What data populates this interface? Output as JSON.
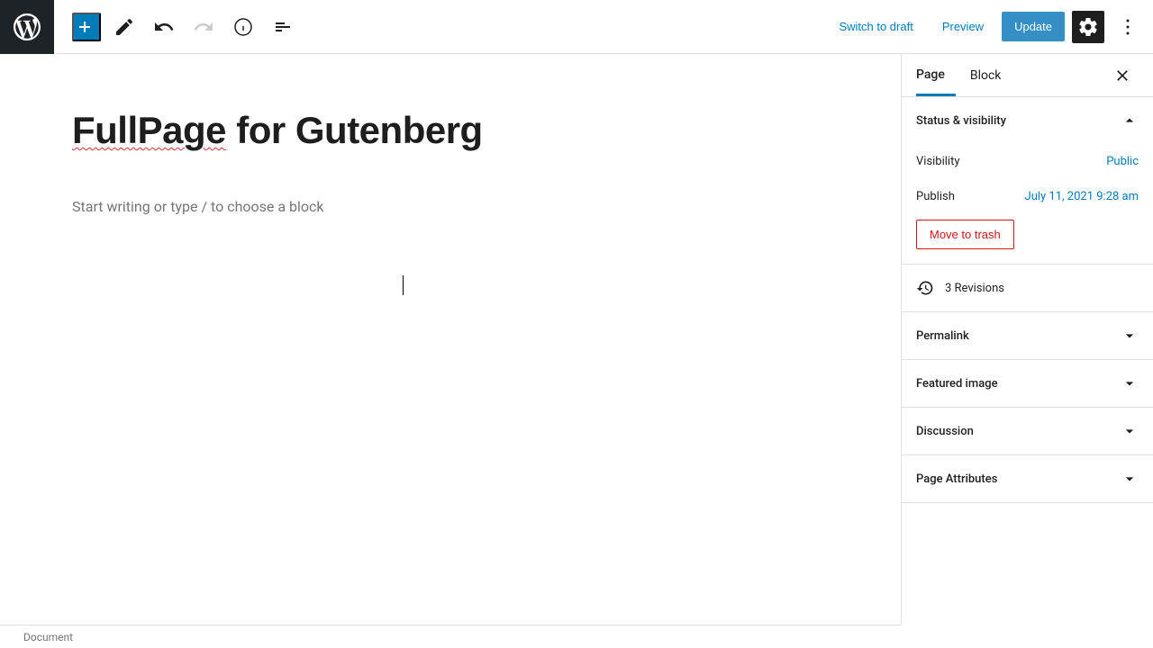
{
  "header": {
    "switch_draft": "Switch to draft",
    "preview": "Preview",
    "update": "Update"
  },
  "editor": {
    "title_word1": "FullPage",
    "title_rest": " for Gutenberg",
    "placeholder": "Start writing or type / to choose a block"
  },
  "sidebar": {
    "tabs": {
      "page": "Page",
      "block": "Block"
    },
    "status": {
      "title": "Status & visibility",
      "visibility_label": "Visibility",
      "visibility_value": "Public",
      "publish_label": "Publish",
      "publish_value": "July 11, 2021 9:28 am",
      "trash": "Move to trash"
    },
    "revisions": "3 Revisions",
    "panels": {
      "permalink": "Permalink",
      "featured_image": "Featured image",
      "discussion": "Discussion",
      "page_attributes": "Page Attributes"
    }
  },
  "footer": {
    "document": "Document"
  }
}
